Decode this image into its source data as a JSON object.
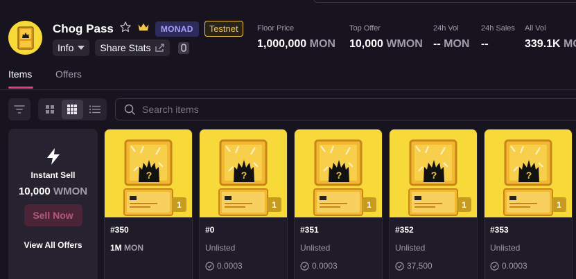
{
  "collection": {
    "name": "Chog Pass",
    "chain_badge": "MONAD",
    "network_badge": "Testnet"
  },
  "actions": {
    "info_label": "Info",
    "share_label": "Share Stats"
  },
  "stats": [
    {
      "label": "Floor Price",
      "value": "1,000,000",
      "unit": "MON"
    },
    {
      "label": "Top Offer",
      "value": "10,000",
      "unit": "WMON"
    },
    {
      "label": "24h Vol",
      "value": "--",
      "unit": "MON"
    },
    {
      "label": "24h Sales",
      "value": "--",
      "unit": ""
    },
    {
      "label": "All Vol",
      "value": "339.1K",
      "unit": "MON"
    }
  ],
  "tabs": {
    "items": "Items",
    "offers": "Offers"
  },
  "search": {
    "placeholder": "Search items"
  },
  "instant_sell": {
    "label": "Instant Sell",
    "amount": "10,000",
    "unit": "WMON",
    "button": "Sell Now",
    "view_all": "View All Offers"
  },
  "items": [
    {
      "name": "#350",
      "price": "1M",
      "unit": "MON",
      "status": "",
      "last": "",
      "qty": "1"
    },
    {
      "name": "#0",
      "price": "",
      "unit": "",
      "status": "Unlisted",
      "last": "0.0003",
      "qty": "1"
    },
    {
      "name": "#351",
      "price": "",
      "unit": "",
      "status": "Unlisted",
      "last": "0.0003",
      "qty": "1"
    },
    {
      "name": "#352",
      "price": "",
      "unit": "",
      "status": "Unlisted",
      "last": "37,500",
      "qty": "1"
    },
    {
      "name": "#353",
      "price": "",
      "unit": "",
      "status": "Unlisted",
      "last": "0.0003",
      "qty": "1"
    }
  ],
  "colors": {
    "background": "#17141f",
    "accent": "#e23a7a",
    "card_art": "#f7d93a",
    "badge_monad": "#a7a2ff",
    "badge_testnet": "#f3c745"
  }
}
